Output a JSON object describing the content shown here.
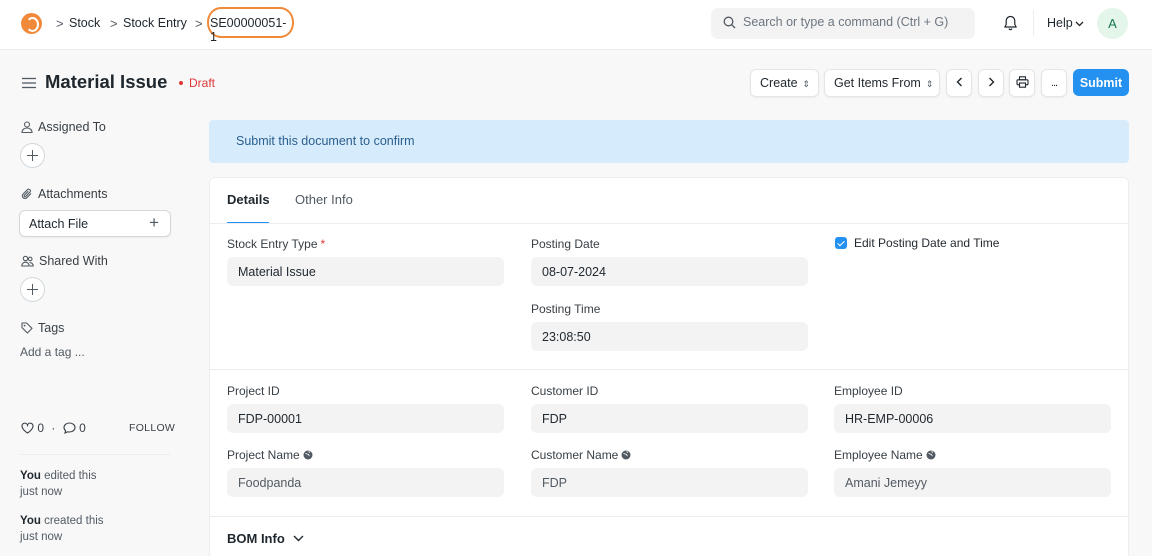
{
  "breadcrumb": {
    "items": [
      "Stock",
      "Stock Entry"
    ],
    "current": "SE00000051-1",
    "separator": ">"
  },
  "search": {
    "placeholder": "Search or type a command (Ctrl + G)"
  },
  "nav": {
    "help_label": "Help",
    "avatar_initial": "A"
  },
  "page": {
    "title": "Material Issue",
    "status": "Draft"
  },
  "toolbar": {
    "create_label": "Create",
    "get_items_label": "Get Items From",
    "more_label": "...",
    "submit_label": "Submit"
  },
  "sidebar": {
    "assigned_to": "Assigned To",
    "attachments": "Attachments",
    "attach_file": "Attach File",
    "attach_plus": "+",
    "shared_with": "Shared With",
    "tags": "Tags",
    "add_tag": "Add a tag ...",
    "likes": "0",
    "comments": "0",
    "like_sep": "·",
    "follow": "FOLLOW",
    "activity": [
      {
        "user": "You",
        "action": " edited this",
        "time": "just now"
      },
      {
        "user": "You",
        "action": " created this",
        "time": "just now"
      }
    ]
  },
  "alert": {
    "message": "Submit this document to confirm"
  },
  "tabs": [
    {
      "label": "Details"
    },
    {
      "label": "Other Info"
    }
  ],
  "form": {
    "stock_entry_type": {
      "label": "Stock Entry Type",
      "required": "*",
      "value": "Material Issue"
    },
    "posting_date": {
      "label": "Posting Date",
      "value": "08-07-2024"
    },
    "posting_time": {
      "label": "Posting Time",
      "value": "23:08:50"
    },
    "edit_posting": {
      "label": "Edit Posting Date and Time",
      "checked": true
    },
    "project_id": {
      "label": "Project ID",
      "value": "FDP-00001"
    },
    "customer_id": {
      "label": "Customer ID",
      "value": "FDP"
    },
    "employee_id": {
      "label": "Employee ID",
      "value": "HR-EMP-00006"
    },
    "project_name": {
      "label": "Project Name",
      "value": "Foodpanda"
    },
    "customer_name": {
      "label": "Customer Name",
      "value": "FDP"
    },
    "employee_name": {
      "label": "Employee Name",
      "value": "Amani Jemeyy"
    }
  },
  "bom_section": {
    "label": "BOM Info"
  },
  "colors": {
    "primary": "#2490ef",
    "alert_bg": "#d6ebfc",
    "draft": "#e03636",
    "highlight": "#f08a3a"
  }
}
